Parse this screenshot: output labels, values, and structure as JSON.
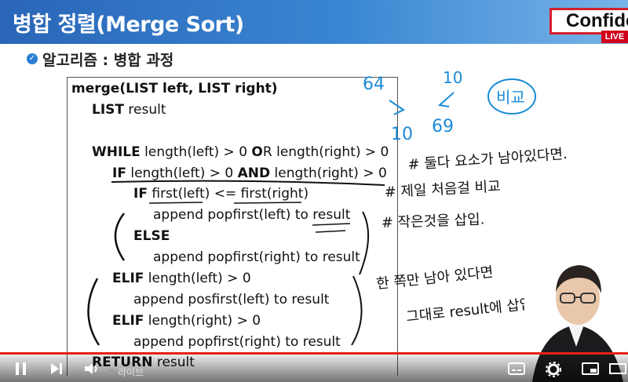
{
  "header": {
    "title": "병합 정렬(Merge Sort)",
    "confidential": "Confidential",
    "live_badge": "LIVE"
  },
  "subtitle": "알고리즘 : 병합 과정",
  "code_lines": [
    "merge(LIST left, LIST right)",
    "LIST result",
    "WHILE length(left) > 0 OR length(right) > 0",
    "IF length(left) > 0 AND length(right) > 0",
    "IF first(left) <= first(right)",
    "append popfirst(left) to result",
    "ELSE",
    "append popfirst(right) to result",
    "ELIF length(left) > 0",
    "append posfirst(left) to result",
    "ELIF length(right) > 0",
    "append popfirst(right) to result",
    "RETURN result"
  ],
  "annotations": {
    "num_64": "64",
    "num_10_top": "10",
    "num_10_bottom": "10",
    "num_69": "69",
    "compare": "비교",
    "note1": "# 둘다 요소가 남아있다면.",
    "note2": "# 제일 처음걸 비교",
    "note3": "# 작은것을 삽입.",
    "note4": "한 쪽만 남아 있다면",
    "note5": "그대로 result에 삽입."
  },
  "player": {
    "live_label": "라이브",
    "progress": 1.0,
    "colors": {
      "progress": "#e62117",
      "accent": "#2a66b8"
    }
  }
}
